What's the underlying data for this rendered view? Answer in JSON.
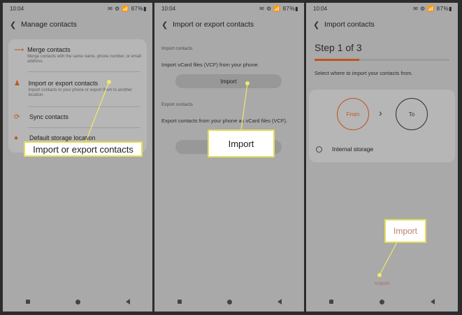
{
  "screens": [
    {
      "status_time": "10:04",
      "status_right": "✉ ⚙ 📶 87%▮",
      "header_title": "Manage contacts",
      "rows": [
        {
          "title": "Merge contacts",
          "sub": "Merge contacts with the same name, phone number, or email address."
        },
        {
          "title": "Import or export contacts",
          "sub": "Import contacts to your phone or export them to another location."
        },
        {
          "title": "Sync contacts",
          "sub": ""
        },
        {
          "title": "Default storage location",
          "sub": ""
        }
      ],
      "callout": "Import or export contacts"
    },
    {
      "status_time": "10:04",
      "status_right": "✉ ⚙ 📶 87%▮",
      "header_title": "Import or export contacts",
      "import_section_label": "Import contacts",
      "import_desc": "Import vCard files (VCF) from your phone.",
      "import_button": "Import",
      "export_section_label": "Export contacts",
      "export_desc": "Export contacts from your phone as vCard files (VCF).",
      "callout": "Import"
    },
    {
      "status_time": "10:04",
      "status_right": "✉ ⚙ 📶 87%▮",
      "header_title": "Import contacts",
      "step_label": "Step 1 of 3",
      "progress_fraction": 0.33,
      "instruction": "Select where to import your contacts from.",
      "from_label": "From",
      "to_label": "To",
      "radio_label": "Internal storage",
      "bottom_button": "Import",
      "callout": "Import"
    }
  ],
  "colors": {
    "accent": "#c0541d",
    "highlight": "#efe86a",
    "screen_bg": "#a9a9a9"
  }
}
